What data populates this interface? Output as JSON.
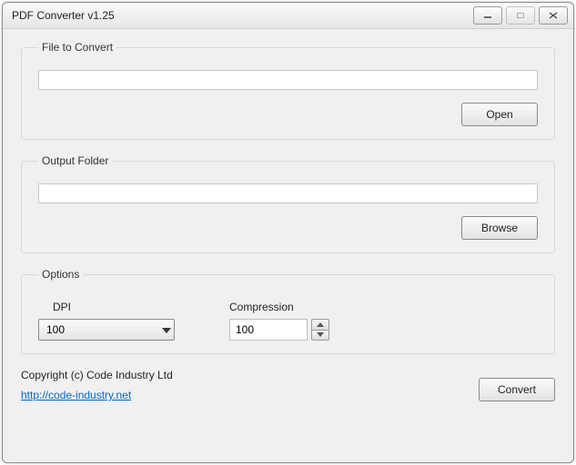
{
  "window": {
    "title": "PDF Converter v1.25"
  },
  "groups": {
    "file": {
      "legend": "File to Convert",
      "input_value": "",
      "open_label": "Open"
    },
    "output": {
      "legend": "Output Folder",
      "input_value": "",
      "browse_label": "Browse"
    },
    "options": {
      "legend": "Options",
      "dpi": {
        "label": "DPI",
        "value": "100"
      },
      "compression": {
        "label": "Compression",
        "value": "100"
      }
    }
  },
  "footer": {
    "copyright": "Copyright (c) Code Industry Ltd",
    "link_text": "http://code-industry.net",
    "convert_label": "Convert"
  }
}
